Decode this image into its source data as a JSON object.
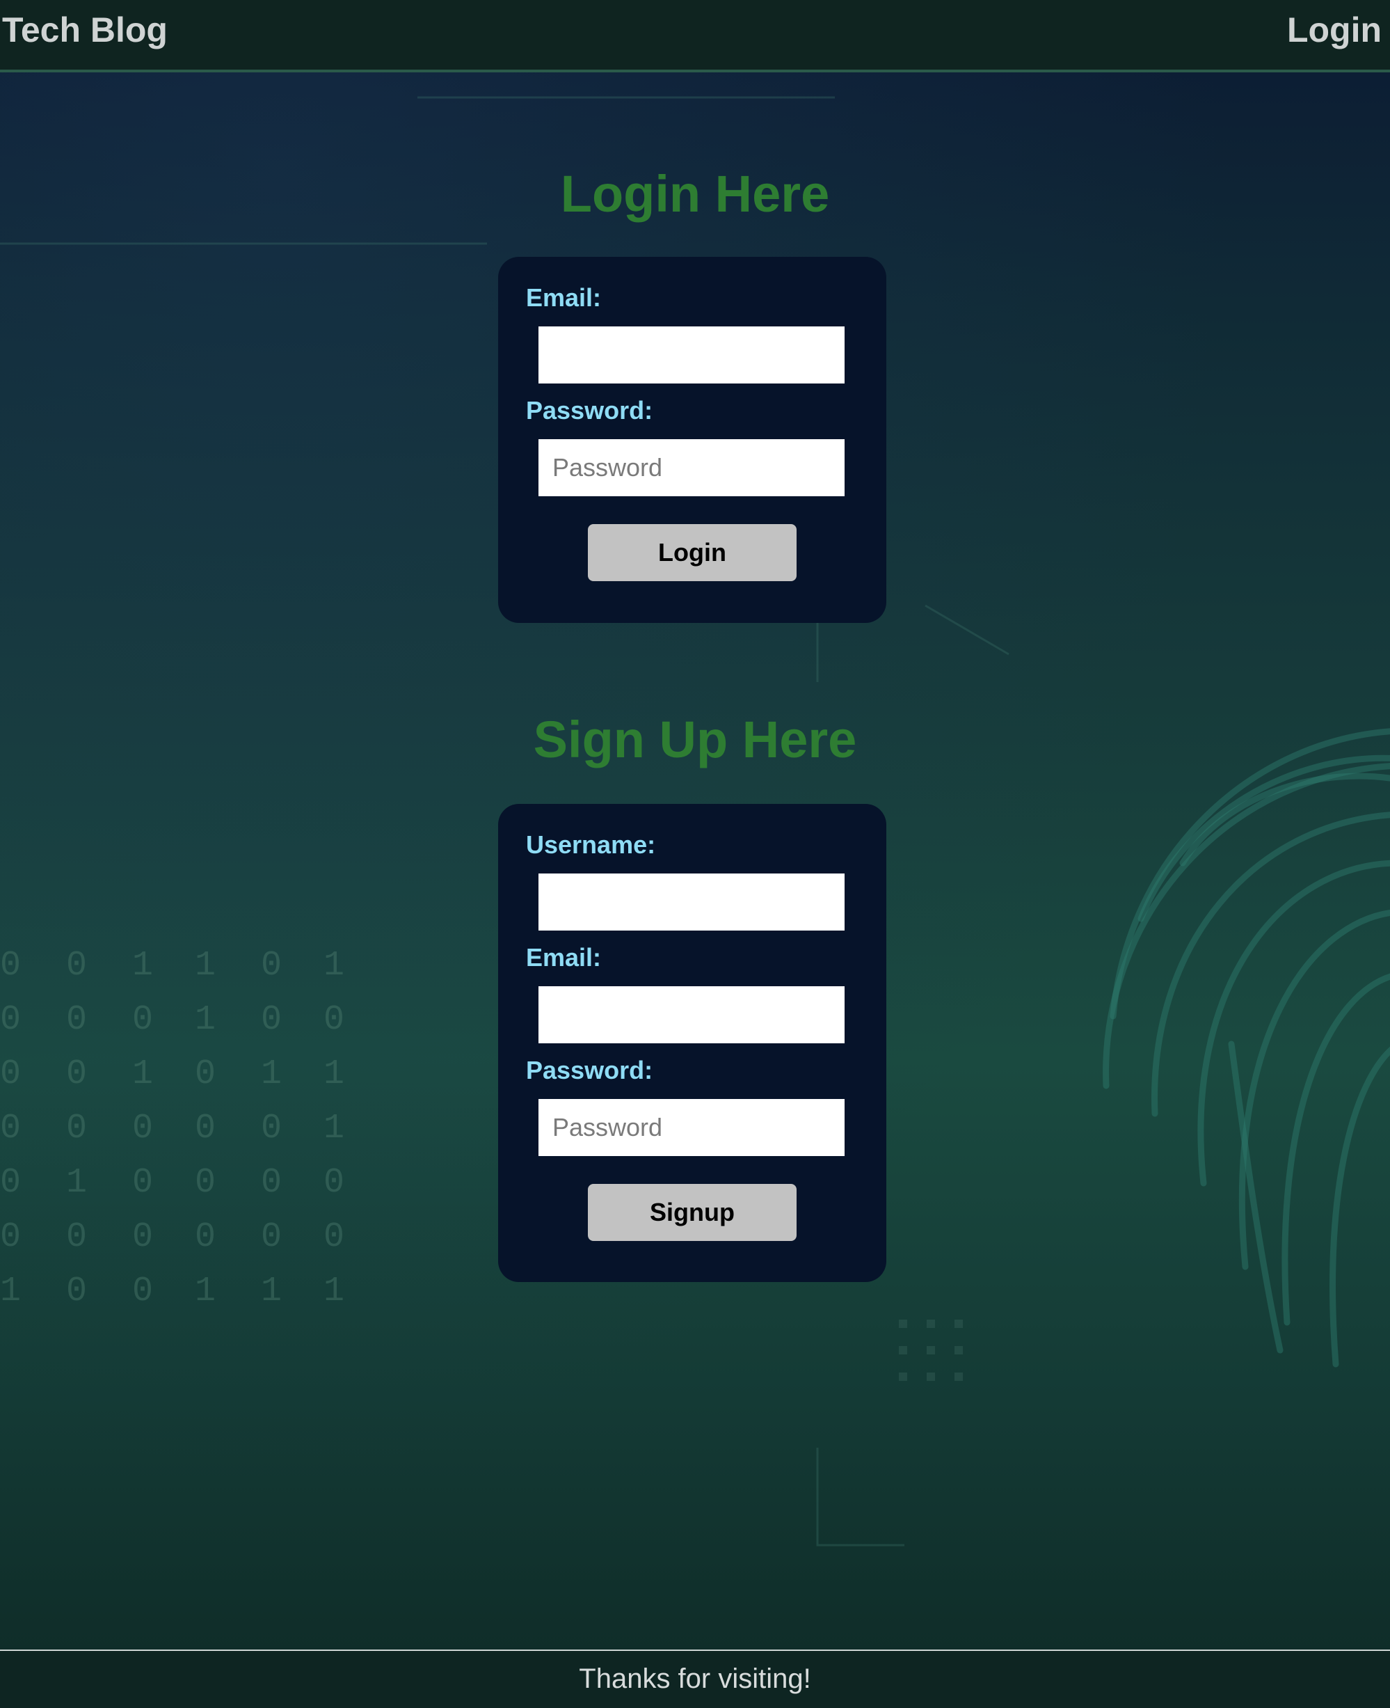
{
  "header": {
    "brand": "Tech Blog",
    "nav_login": "Login"
  },
  "login": {
    "title": "Login Here",
    "email_label": "Email:",
    "email_value": "",
    "email_placeholder": "",
    "password_label": "Password:",
    "password_value": "",
    "password_placeholder": "Password",
    "submit_label": "Login"
  },
  "signup": {
    "title": "Sign Up Here",
    "username_label": "Username:",
    "username_value": "",
    "username_placeholder": "",
    "email_label": "Email:",
    "email_value": "",
    "email_placeholder": "",
    "password_label": "Password:",
    "password_value": "",
    "password_placeholder": "Password",
    "submit_label": "Signup"
  },
  "footer": {
    "text": "Thanks for visiting!"
  },
  "colors": {
    "heading_green": "#2e7d32",
    "label_cyan": "#8fdcf5",
    "card_navy": "#06132a",
    "button_gray": "#c2c2c2"
  }
}
